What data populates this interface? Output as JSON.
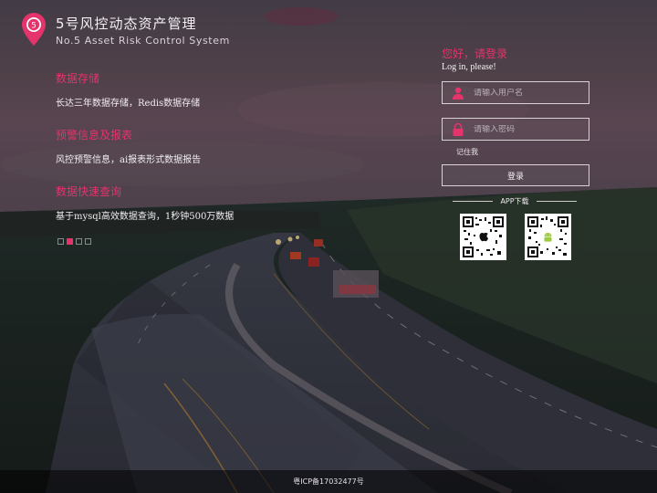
{
  "header": {
    "title": "5号风控动态资产管理",
    "subtitle": "No.5 Asset Risk Control System",
    "logo_number": "5"
  },
  "features": [
    {
      "title": "数据存储",
      "desc": "长达三年数据存储，Redis数据存储"
    },
    {
      "title": "预警信息及报表",
      "desc": "风控预警信息，ai报表形式数据报告"
    },
    {
      "title": "数据快速查询",
      "desc": "基于mysql高效数据查询，1秒钟500万数据"
    }
  ],
  "carousel": {
    "count": 4,
    "active_index": 1
  },
  "login": {
    "greeting": "您好，请登录",
    "subtitle": "Log in, please!",
    "username_placeholder": "请输入用户名",
    "password_placeholder": "请输入密码",
    "remember_label": "记住我",
    "submit_label": "登录",
    "app_download_label": "APP下载"
  },
  "footer": {
    "icp": "粤ICP备17032477号"
  },
  "colors": {
    "accent": "#e5336b"
  }
}
